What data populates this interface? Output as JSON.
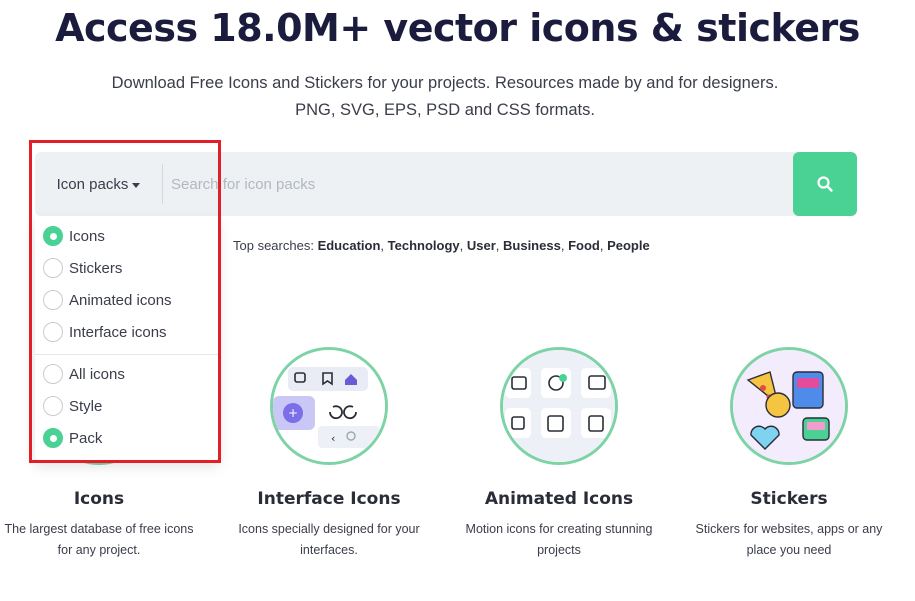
{
  "hero": {
    "title": "Access 18.0M+ vector icons & stickers",
    "subtitle_line1": "Download Free Icons and Stickers for your projects. Resources made by and for designers.",
    "subtitle_line2": "PNG, SVG, EPS, PSD and CSS formats."
  },
  "search": {
    "type_selector_label": "Icon packs",
    "placeholder": "Search for icon packs",
    "button_icon": "search-icon",
    "accent_color": "#4ad295"
  },
  "top_searches": {
    "label": "Top searches:",
    "items": [
      "Education",
      "Technology",
      "User",
      "Business",
      "Food",
      "People"
    ]
  },
  "dropdown": {
    "group1": [
      {
        "label": "Icons",
        "selected": true
      },
      {
        "label": "Stickers",
        "selected": false
      },
      {
        "label": "Animated icons",
        "selected": false
      },
      {
        "label": "Interface icons",
        "selected": false
      }
    ],
    "group2": [
      {
        "label": "All icons",
        "selected": false
      },
      {
        "label": "Style",
        "selected": false
      },
      {
        "label": "Pack",
        "selected": true
      }
    ]
  },
  "categories": [
    {
      "title": "Icons",
      "desc_line1": "The largest database of free icons",
      "desc_line2": "for any project."
    },
    {
      "title": "Interface Icons",
      "desc_line1": "Icons specially designed for your",
      "desc_line2": "interfaces."
    },
    {
      "title": "Animated Icons",
      "desc_line1": "Motion icons for creating stunning",
      "desc_line2": "projects"
    },
    {
      "title": "Stickers",
      "desc_line1": "Stickers for websites, apps or any",
      "desc_line2": "place you need"
    }
  ],
  "colors": {
    "highlight": "#e41e26",
    "title": "#1b1c3d"
  }
}
